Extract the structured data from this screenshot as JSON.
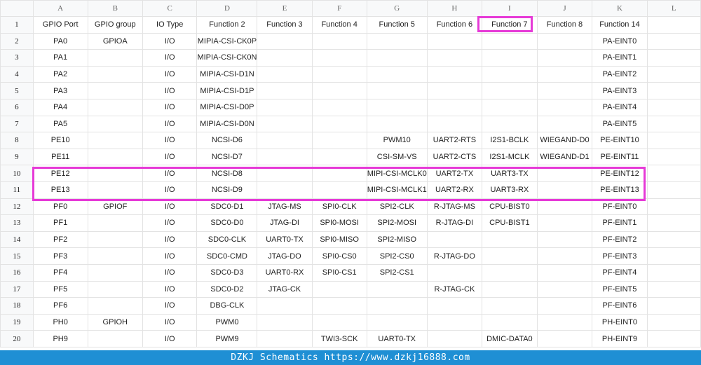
{
  "column_letters": [
    "A",
    "B",
    "C",
    "D",
    "E",
    "F",
    "G",
    "H",
    "I",
    "J",
    "K",
    "L"
  ],
  "rows": [
    {
      "n": "1",
      "cells": [
        "GPIO Port",
        "GPIO group",
        "IO Type",
        "Function 2",
        "Function 3",
        "Function 4",
        "Function 5",
        "Function 6",
        "Function 7",
        "Function 8",
        "Function 14",
        ""
      ]
    },
    {
      "n": "2",
      "cells": [
        "PA0",
        "GPIOA",
        "I/O",
        "MIPIA-CSI-CK0P",
        "",
        "",
        "",
        "",
        "",
        "",
        "PA-EINT0",
        ""
      ]
    },
    {
      "n": "3",
      "cells": [
        "PA1",
        "",
        "I/O",
        "MIPIA-CSI-CK0N",
        "",
        "",
        "",
        "",
        "",
        "",
        "PA-EINT1",
        ""
      ]
    },
    {
      "n": "4",
      "cells": [
        "PA2",
        "",
        "I/O",
        "MIPIA-CSI-D1N",
        "",
        "",
        "",
        "",
        "",
        "",
        "PA-EINT2",
        ""
      ]
    },
    {
      "n": "5",
      "cells": [
        "PA3",
        "",
        "I/O",
        "MIPIA-CSI-D1P",
        "",
        "",
        "",
        "",
        "",
        "",
        "PA-EINT3",
        ""
      ]
    },
    {
      "n": "6",
      "cells": [
        "PA4",
        "",
        "I/O",
        "MIPIA-CSI-D0P",
        "",
        "",
        "",
        "",
        "",
        "",
        "PA-EINT4",
        ""
      ]
    },
    {
      "n": "7",
      "cells": [
        "PA5",
        "",
        "I/O",
        "MIPIA-CSI-D0N",
        "",
        "",
        "",
        "",
        "",
        "",
        "PA-EINT5",
        ""
      ]
    },
    {
      "n": "8",
      "cells": [
        "PE10",
        "",
        "I/O",
        "NCSI-D6",
        "",
        "",
        "PWM10",
        "UART2-RTS",
        "I2S1-BCLK",
        "WIEGAND-D0",
        "PE-EINT10",
        ""
      ]
    },
    {
      "n": "9",
      "cells": [
        "PE11",
        "",
        "I/O",
        "NCSI-D7",
        "",
        "",
        "CSI-SM-VS",
        "UART2-CTS",
        "I2S1-MCLK",
        "WIEGAND-D1",
        "PE-EINT11",
        ""
      ]
    },
    {
      "n": "10",
      "cells": [
        "PE12",
        "",
        "I/O",
        "NCSI-D8",
        "",
        "",
        "MIPI-CSI-MCLK0",
        "UART2-TX",
        "UART3-TX",
        "",
        "PE-EINT12",
        ""
      ]
    },
    {
      "n": "11",
      "cells": [
        "PE13",
        "",
        "I/O",
        "NCSI-D9",
        "",
        "",
        "MIPI-CSI-MCLK1",
        "UART2-RX",
        "UART3-RX",
        "",
        "PE-EINT13",
        ""
      ]
    },
    {
      "n": "12",
      "cells": [
        "PF0",
        "GPIOF",
        "I/O",
        "SDC0-D1",
        "JTAG-MS",
        "SPI0-CLK",
        "SPI2-CLK",
        "R-JTAG-MS",
        "CPU-BIST0",
        "",
        "PF-EINT0",
        ""
      ]
    },
    {
      "n": "13",
      "cells": [
        "PF1",
        "",
        "I/O",
        "SDC0-D0",
        "JTAG-DI",
        "SPI0-MOSI",
        "SPI2-MOSI",
        "R-JTAG-DI",
        "CPU-BIST1",
        "",
        "PF-EINT1",
        ""
      ]
    },
    {
      "n": "14",
      "cells": [
        "PF2",
        "",
        "I/O",
        "SDC0-CLK",
        "UART0-TX",
        "SPI0-MISO",
        "SPI2-MISO",
        "",
        "",
        "",
        "PF-EINT2",
        ""
      ]
    },
    {
      "n": "15",
      "cells": [
        "PF3",
        "",
        "I/O",
        "SDC0-CMD",
        "JTAG-DO",
        "SPI0-CS0",
        "SPI2-CS0",
        "R-JTAG-DO",
        "",
        "",
        "PF-EINT3",
        ""
      ]
    },
    {
      "n": "16",
      "cells": [
        "PF4",
        "",
        "I/O",
        "SDC0-D3",
        "UART0-RX",
        "SPI0-CS1",
        "SPI2-CS1",
        "",
        "",
        "",
        "PF-EINT4",
        ""
      ]
    },
    {
      "n": "17",
      "cells": [
        "PF5",
        "",
        "I/O",
        "SDC0-D2",
        "JTAG-CK",
        "",
        "",
        "R-JTAG-CK",
        "",
        "",
        "PF-EINT5",
        ""
      ]
    },
    {
      "n": "18",
      "cells": [
        "PF6",
        "",
        "I/O",
        "DBG-CLK",
        "",
        "",
        "",
        "",
        "",
        "",
        "PF-EINT6",
        ""
      ]
    },
    {
      "n": "19",
      "cells": [
        "PH0",
        "GPIOH",
        "I/O",
        "PWM0",
        "",
        "",
        "",
        "",
        "",
        "",
        "PH-EINT0",
        ""
      ]
    },
    {
      "n": "20",
      "cells": [
        "PH9",
        "",
        "I/O",
        "PWM9",
        "",
        "TWI3-SCK",
        "UART0-TX",
        "",
        "DMIC-DATA0",
        "",
        "PH-EINT9",
        ""
      ]
    }
  ],
  "highlight_color": "#e63ad7",
  "footer": {
    "text": "DZKJ Schematics https://www.dzkj16888.com",
    "bg_color": "#1f8fd4"
  }
}
